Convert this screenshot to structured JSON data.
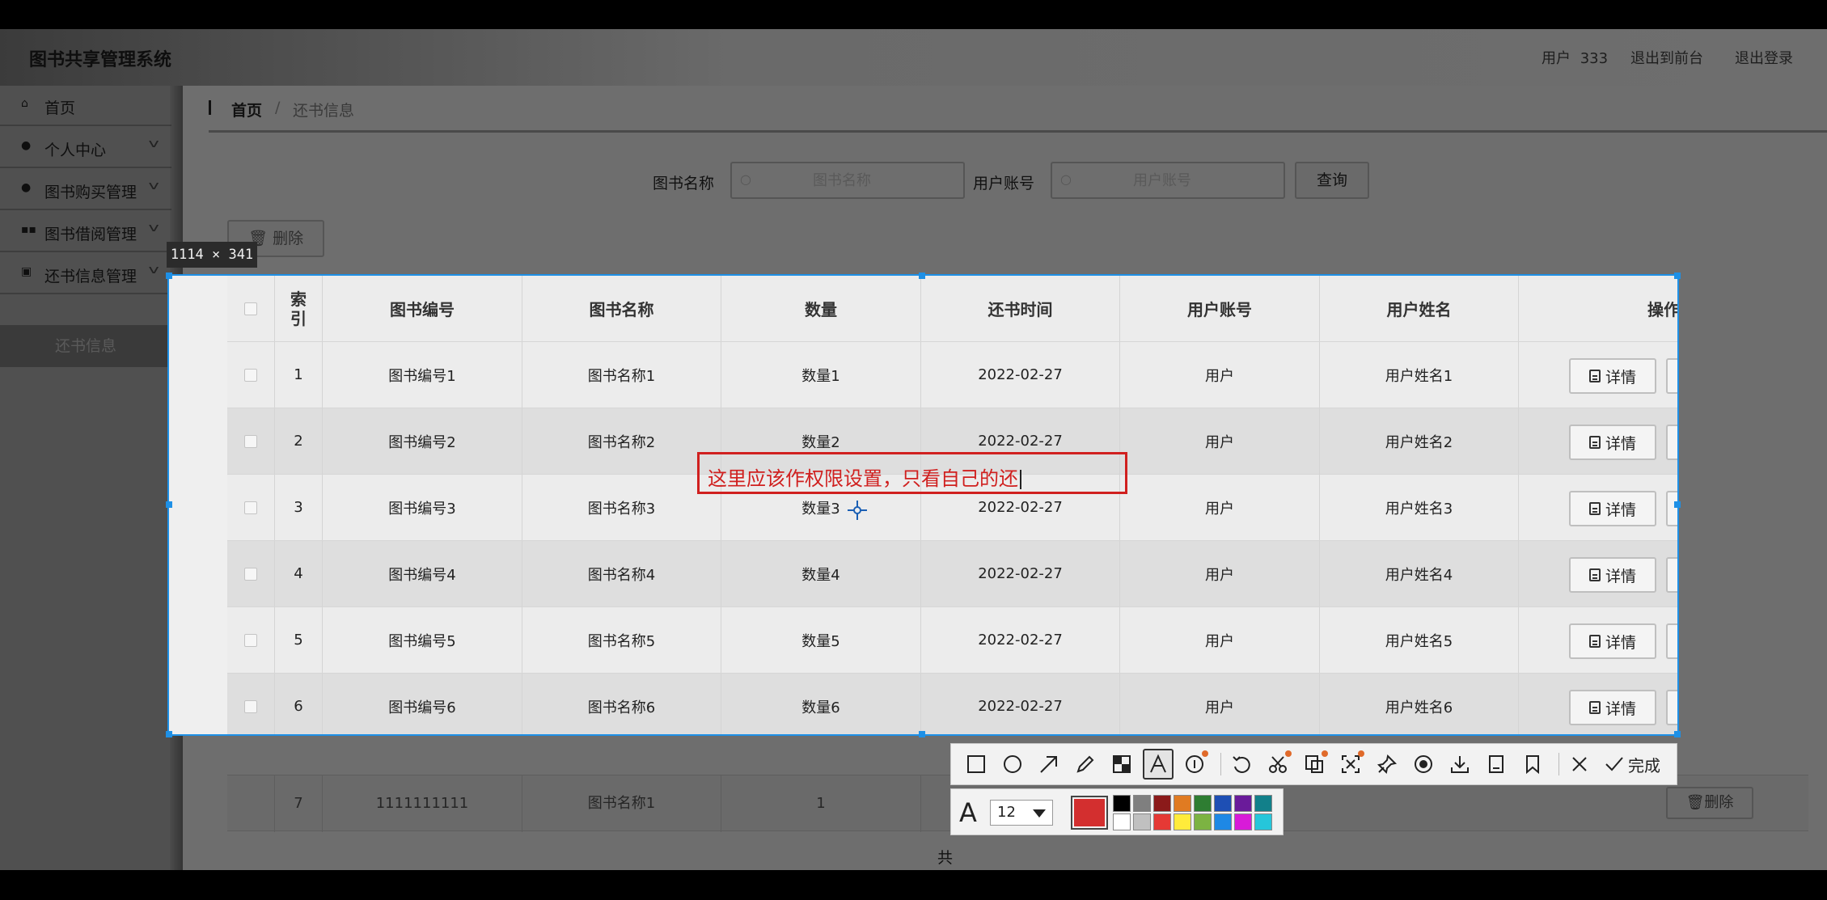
{
  "app": {
    "title": "图书共享管理系统",
    "user_label": "用户",
    "user_name": "333",
    "back_to_front": "退出到前台",
    "logout": "退出登录"
  },
  "sidebar": {
    "items": [
      {
        "label": "首页",
        "icon": "home-icon"
      },
      {
        "label": "个人中心",
        "icon": "user-icon"
      },
      {
        "label": "图书购买管理",
        "icon": "user-icon"
      },
      {
        "label": "图书借阅管理",
        "icon": "grid-icon"
      },
      {
        "label": "还书信息管理",
        "icon": "image-icon"
      }
    ],
    "active_sub": "还书信息"
  },
  "breadcrumb": {
    "home": "首页",
    "sep": "/",
    "current": "还书信息"
  },
  "search": {
    "book_name_label": "图书名称",
    "book_name_placeholder": "图书名称",
    "account_label": "用户账号",
    "account_placeholder": "用户账号",
    "query_button": "查询"
  },
  "actions": {
    "delete": "删除",
    "detail": "详情"
  },
  "table": {
    "headers": [
      "索\n引",
      "图书编号",
      "图书名称",
      "数量",
      "还书时间",
      "用户账号",
      "用户姓名",
      "操作"
    ],
    "rows": [
      {
        "index": "1",
        "book_no": "图书编号1",
        "book_name": "图书名称1",
        "qty": "数量1",
        "date": "2022-02-27",
        "account": "用户",
        "user_name": "用户姓名1"
      },
      {
        "index": "2",
        "book_no": "图书编号2",
        "book_name": "图书名称2",
        "qty": "数量2",
        "date": "2022-02-27",
        "account": "用户",
        "user_name": "用户姓名2"
      },
      {
        "index": "3",
        "book_no": "图书编号3",
        "book_name": "图书名称3",
        "qty": "数量3",
        "date": "2022-02-27",
        "account": "用户",
        "user_name": "用户姓名3"
      },
      {
        "index": "4",
        "book_no": "图书编号4",
        "book_name": "图书名称4",
        "qty": "数量4",
        "date": "2022-02-27",
        "account": "用户",
        "user_name": "用户姓名4"
      },
      {
        "index": "5",
        "book_no": "图书编号5",
        "book_name": "图书名称5",
        "qty": "数量5",
        "date": "2022-02-27",
        "account": "用户",
        "user_name": "用户姓名5"
      },
      {
        "index": "6",
        "book_no": "图书编号6",
        "book_name": "图书名称6",
        "qty": "数量6",
        "date": "2022-02-27",
        "account": "用户",
        "user_name": "用户姓名6"
      }
    ],
    "dim_row": {
      "index": "7",
      "book_no": "1111111111",
      "book_name": "图书名称1",
      "qty": "1"
    }
  },
  "pager_partial": "共",
  "screenshot_tool": {
    "size_label": "1114 × 341",
    "annotation_text": "这里应该作权限设置，只看自己的还",
    "done_label": "完成",
    "font_size": "12",
    "current_color": "#d32f2f",
    "palette": [
      "#000000",
      "#7f7f7f",
      "#8b1a1a",
      "#e07b22",
      "#2e7d32",
      "#1e4fb4",
      "#6a1b9a",
      "#12808a",
      "#ffffff",
      "#c0c0c0",
      "#e53935",
      "#ffeb3b",
      "#7cb342",
      "#1e88e5",
      "#d81bd8",
      "#26c6da"
    ]
  }
}
